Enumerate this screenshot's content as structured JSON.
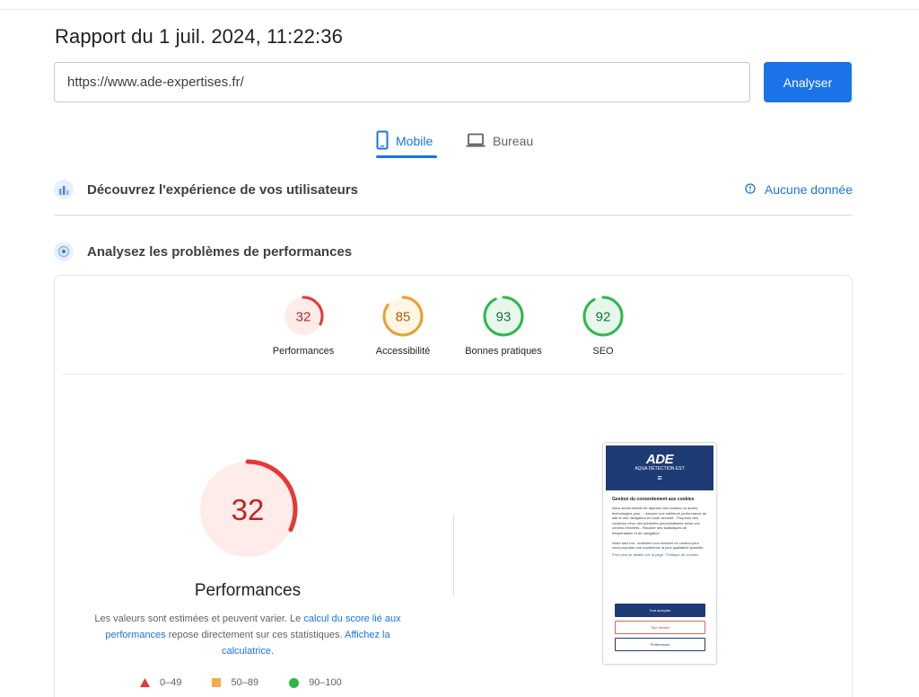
{
  "header": {
    "title": "Rapport du 1 juil. 2024, 11:22:36"
  },
  "search": {
    "url_value": "https://www.ade-expertises.fr/",
    "analyze_label": "Analyser"
  },
  "tabs": [
    {
      "label": "Mobile",
      "active": true,
      "icon": "smartphone-icon"
    },
    {
      "label": "Bureau",
      "active": false,
      "icon": "laptop-icon"
    }
  ],
  "field_data": {
    "title": "Découvrez l'expérience de vos utilisateurs",
    "status": "Aucune donnée"
  },
  "lab_data": {
    "title": "Analysez les problèmes de performances"
  },
  "scores": [
    {
      "label": "Performances",
      "value": 32,
      "color": "#e53935",
      "bg": "#fdecea"
    },
    {
      "label": "Accessibilité",
      "value": 85,
      "color": "#e8a033",
      "bg": "#fff6e6"
    },
    {
      "label": "Bonnes pratiques",
      "value": 93,
      "color": "#2db84d",
      "bg": "#e8f7ec"
    },
    {
      "label": "SEO",
      "value": 92,
      "color": "#2db84d",
      "bg": "#e8f7ec"
    }
  ],
  "performance": {
    "score": "32",
    "title": "Performances",
    "desc_part1": "Les valeurs sont estimées et peuvent varier. Le ",
    "desc_link1": "calcul du score lié aux performances",
    "desc_part2": " repose directement sur ces statistiques. ",
    "desc_link2": "Affichez la calculatrice",
    "desc_part3": "."
  },
  "legend": [
    {
      "shape": "triangle",
      "color": "#e53935",
      "label": "0–49"
    },
    {
      "shape": "square",
      "color": "#f0ad4e",
      "label": "50–89"
    },
    {
      "shape": "circle",
      "color": "#2db84d",
      "label": "90–100"
    }
  ],
  "screenshot": {
    "logo": "ADE",
    "logo_sub": "AQUA DÉTECTION EST",
    "menu": "≡",
    "cookie_title": "Gestion du consentement aux cookies",
    "cookie_text": "Nous avons besoin de déposer des cookies ou autres technologies pour : - Assurer une meilleure performance du site et une navigation en toute sécurité - Proposer des contenus et/ou des publicités personnalisées selon vos centres d'intérêts - Récolter des statistiques de fréquentation et de navigation",
    "cookie_text2": "Notre seul but : améliorer nos services en continu pour vous proposer une expérience la plus qualitative possible.",
    "cookie_link": "Pour plus de détails voir la page : Politique de cookies",
    "btn_accept": "Tout accepter",
    "btn_refuse": "Tout refuser",
    "btn_pref": "Préférences"
  },
  "colors": {
    "accent": "#1a73e8",
    "fail": "#e53935",
    "average": "#e8a033",
    "pass": "#2db84d"
  }
}
